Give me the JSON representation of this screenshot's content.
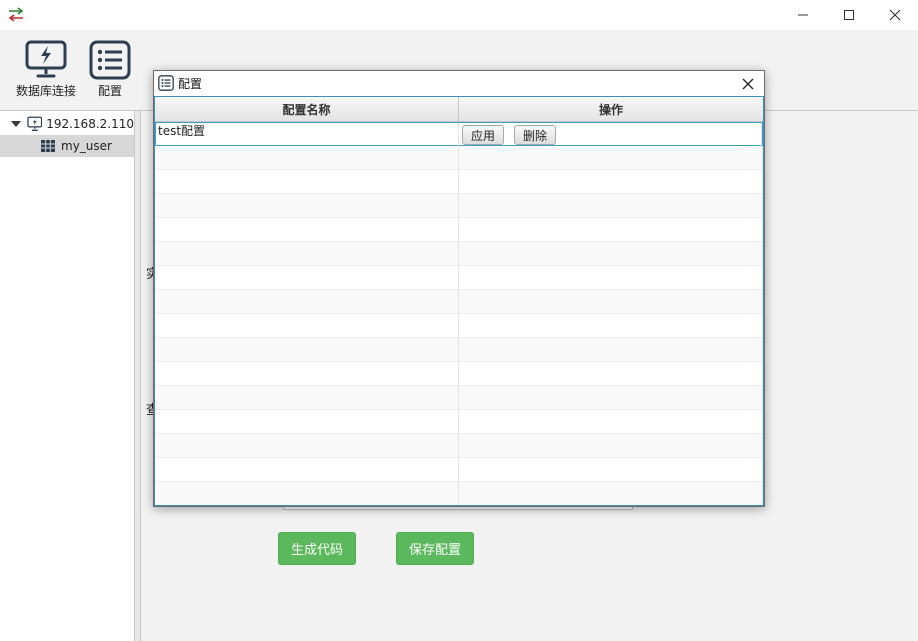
{
  "window": {
    "app_icon": "transfer-arrows-icon",
    "controls": [
      "minimize-icon",
      "maximize-icon",
      "close-icon"
    ]
  },
  "toolbar": {
    "db_connect_label": "数据库连接",
    "config_label": "配置"
  },
  "tree": {
    "host": "192.168.2.110",
    "table": "my_user"
  },
  "background": {
    "label_1": "实",
    "label_2": "查",
    "generate_code": "生成代码",
    "save_config": "保存配置"
  },
  "dialog": {
    "title": "配置",
    "columns": [
      "配置名称",
      "操作"
    ],
    "rows": [
      {
        "name": "test配置",
        "apply": "应用",
        "delete": "删除"
      }
    ]
  },
  "colors": {
    "accent_green": "#5cb85c",
    "selection_border": "#3b9fc9",
    "toolbar_icon": "#2d3e50"
  }
}
